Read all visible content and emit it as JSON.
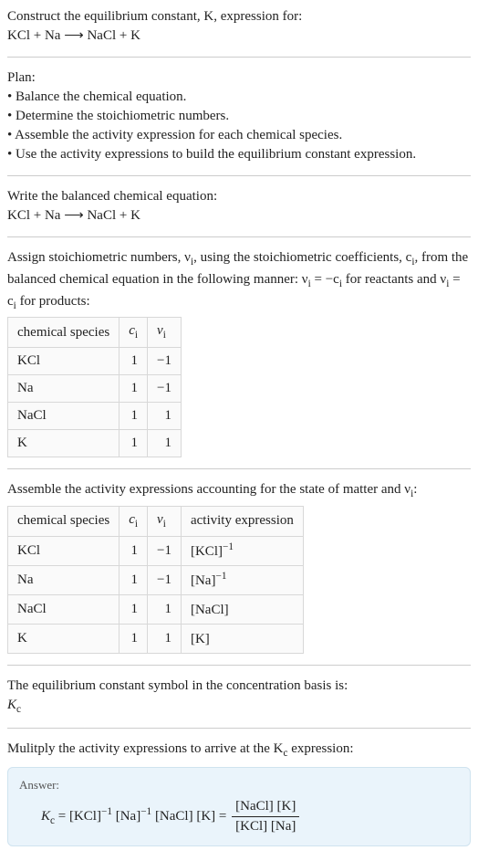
{
  "header": {
    "line1": "Construct the equilibrium constant, K, expression for:",
    "equation": "KCl + Na ⟶ NaCl + K"
  },
  "plan": {
    "title": "Plan:",
    "items": [
      "• Balance the chemical equation.",
      "• Determine the stoichiometric numbers.",
      "• Assemble the activity expression for each chemical species.",
      "• Use the activity expressions to build the equilibrium constant expression."
    ]
  },
  "balanced": {
    "intro": "Write the balanced chemical equation:",
    "equation": "KCl + Na ⟶ NaCl + K"
  },
  "stoich": {
    "intro_a": "Assign stoichiometric numbers, ν",
    "intro_a_sub": "i",
    "intro_b": ", using the stoichiometric coefficients, c",
    "intro_b_sub": "i",
    "intro_c": ", from the balanced chemical equation in the following manner: ν",
    "intro_c_sub": "i",
    "intro_d": " = −c",
    "intro_d_sub": "i",
    "intro_e": " for reactants and ν",
    "intro_e_sub": "i",
    "intro_f": " = c",
    "intro_f_sub": "i",
    "intro_g": " for products:",
    "headers": {
      "species": "chemical species",
      "c": "c",
      "c_sub": "i",
      "v": "ν",
      "v_sub": "i"
    },
    "rows": [
      {
        "species": "KCl",
        "c": "1",
        "v": "−1"
      },
      {
        "species": "Na",
        "c": "1",
        "v": "−1"
      },
      {
        "species": "NaCl",
        "c": "1",
        "v": "1"
      },
      {
        "species": "K",
        "c": "1",
        "v": "1"
      }
    ]
  },
  "activity": {
    "intro_a": "Assemble the activity expressions accounting for the state of matter and ν",
    "intro_a_sub": "i",
    "intro_b": ":",
    "headers": {
      "species": "chemical species",
      "c": "c",
      "c_sub": "i",
      "v": "ν",
      "v_sub": "i",
      "expr": "activity expression"
    },
    "rows": [
      {
        "species": "KCl",
        "c": "1",
        "v": "−1",
        "expr_base": "[KCl]",
        "expr_sup": "−1"
      },
      {
        "species": "Na",
        "c": "1",
        "v": "−1",
        "expr_base": "[Na]",
        "expr_sup": "−1"
      },
      {
        "species": "NaCl",
        "c": "1",
        "v": "1",
        "expr_base": "[NaCl]",
        "expr_sup": ""
      },
      {
        "species": "K",
        "c": "1",
        "v": "1",
        "expr_base": "[K]",
        "expr_sup": ""
      }
    ]
  },
  "kc_symbol": {
    "intro": "The equilibrium constant symbol in the concentration basis is:",
    "symbol": "K",
    "symbol_sub": "c"
  },
  "multiply": {
    "intro_a": "Mulitply the activity expressions to arrive at the K",
    "intro_a_sub": "c",
    "intro_b": " expression:"
  },
  "answer": {
    "label": "Answer:",
    "lhs": "K",
    "lhs_sub": "c",
    "eq1_a": " = [KCl]",
    "eq1_a_sup": "−1",
    "eq1_b": " [Na]",
    "eq1_b_sup": "−1",
    "eq1_c": " [NaCl] [K] = ",
    "frac_num": "[NaCl] [K]",
    "frac_den": "[KCl] [Na]"
  }
}
